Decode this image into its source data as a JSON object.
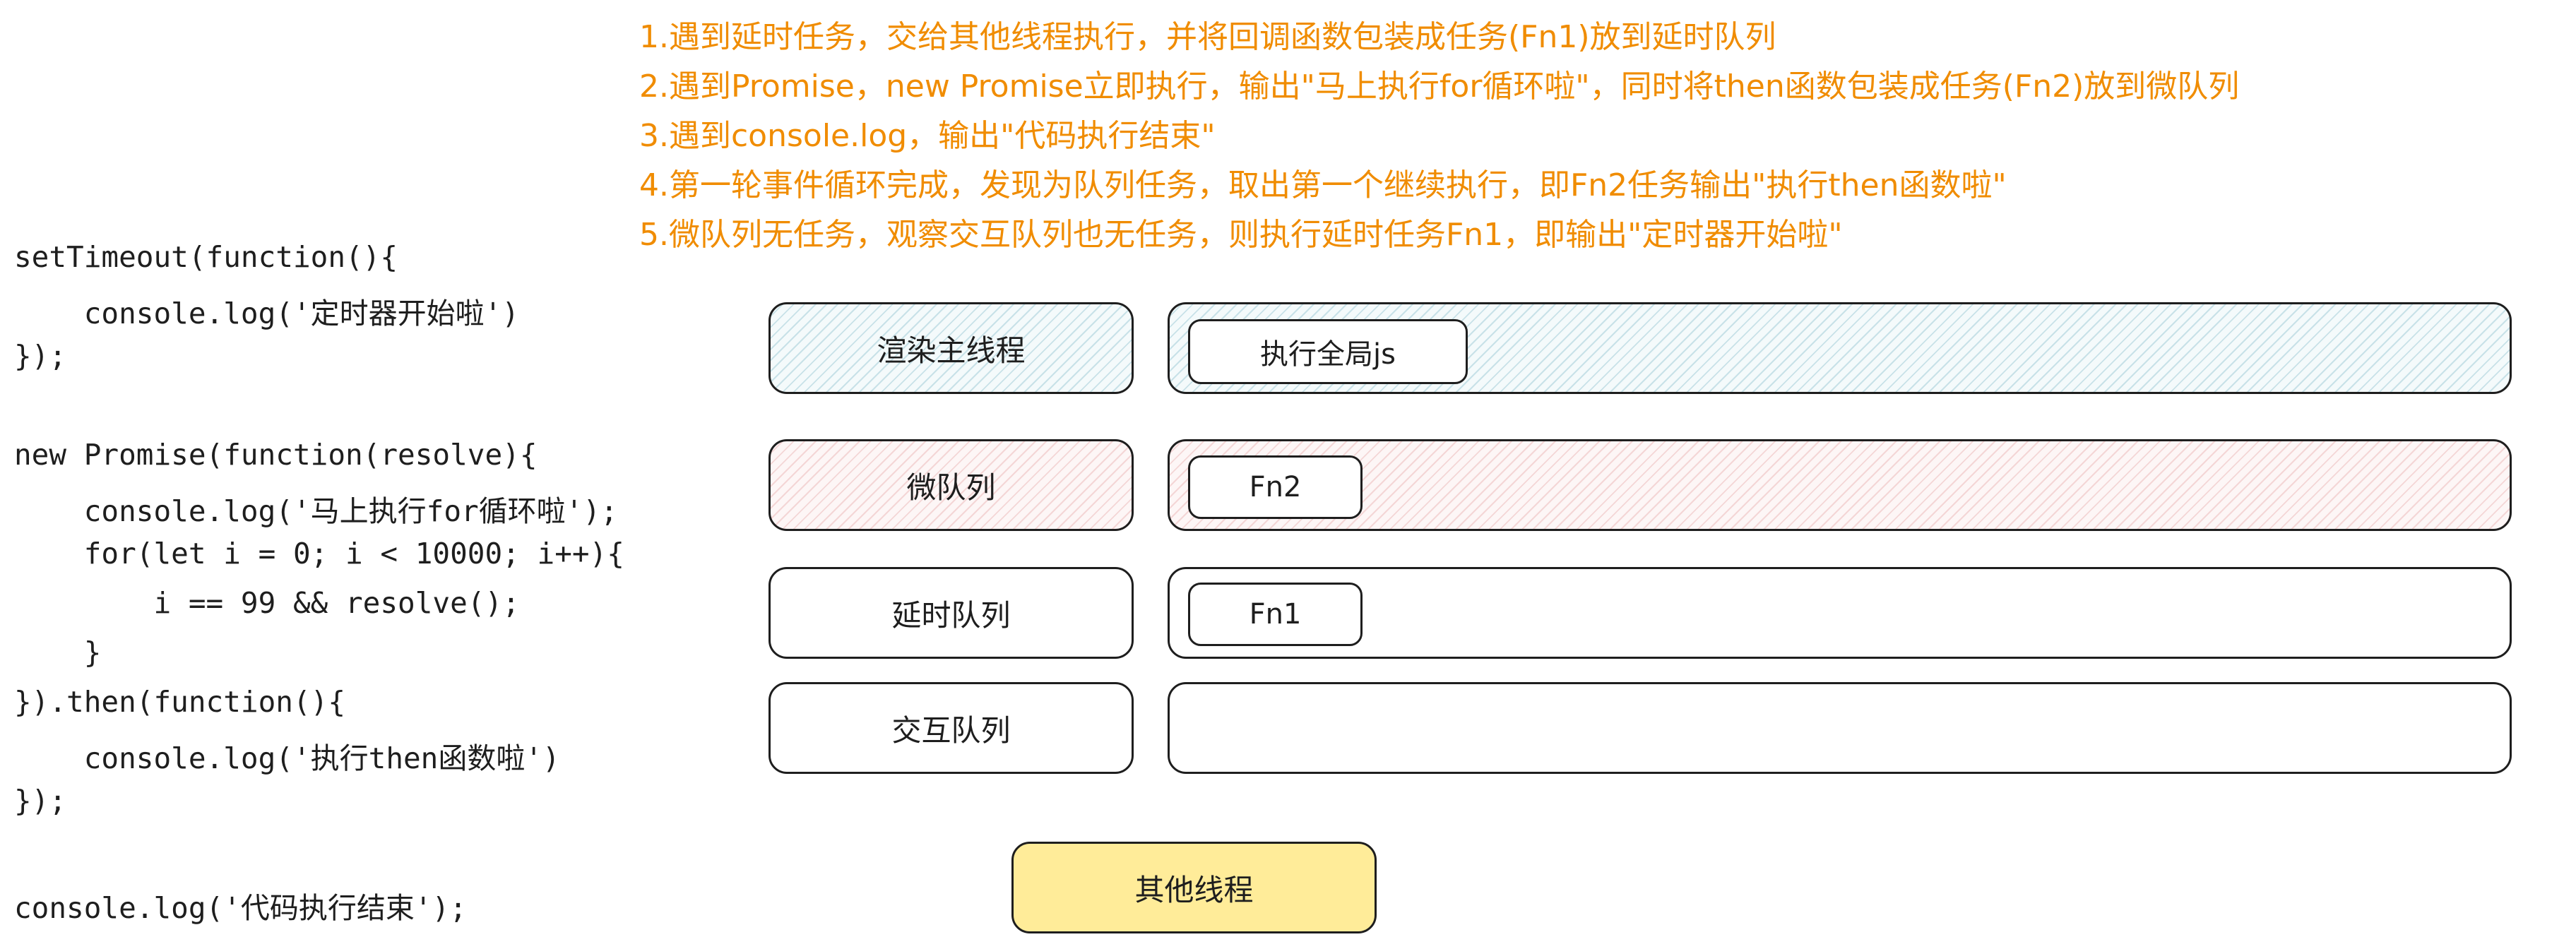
{
  "notes": [
    "1.遇到延时任务，交给其他线程执行，并将回调函数包装成任务(Fn1)放到延时队列",
    "2.遇到Promise，new Promise立即执行，输出\"马上执行for循环啦\"，同时将then函数包装成任务(Fn2)放到微队列",
    "3.遇到console.log，输出\"代码执行结束\"",
    "4.第一轮事件循环完成，发现为队列任务，取出第一个继续执行，即Fn2任务输出\"执行then函数啦\"",
    "5.微队列无任务，观察交互队列也无任务，则执行延时任务Fn1，即输出\"定时器开始啦\""
  ],
  "code": [
    "setTimeout(function(){",
    "    console.log('定时器开始啦')",
    "});",
    "",
    "new Promise(function(resolve){",
    "    console.log('马上执行for循环啦');",
    "    for(let i = 0; i < 10000; i++){",
    "        i == 99 && resolve();",
    "    }",
    "}).then(function(){",
    "    console.log('执行then函数啦')",
    "});",
    "",
    "console.log('代码执行结束');"
  ],
  "queues": [
    {
      "label": "渲染主线程",
      "task": "执行全局js",
      "style": "blue"
    },
    {
      "label": "微队列",
      "task": "Fn2",
      "style": "red"
    },
    {
      "label": "延时队列",
      "task": "Fn1",
      "style": "plain"
    },
    {
      "label": "交互队列",
      "task": "",
      "style": "plain"
    }
  ],
  "other_thread": "其他线程",
  "colors": {
    "note_text": "#f08c00",
    "main_thread_fill": "#a5d8e2",
    "micro_queue_fill": "#ffc9c9",
    "other_thread_fill": "#ffec99",
    "stroke": "#1e1e1e"
  }
}
